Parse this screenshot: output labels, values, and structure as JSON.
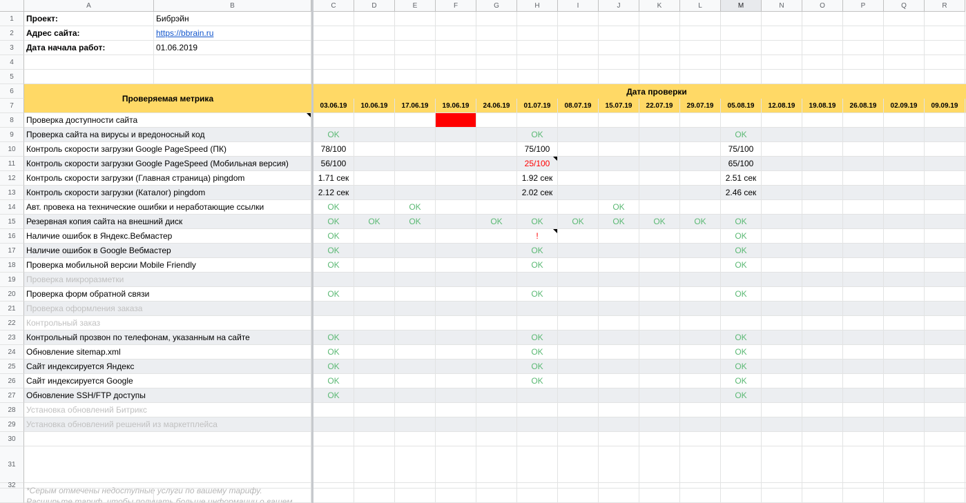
{
  "columns": [
    "A",
    "B",
    "",
    "C",
    "D",
    "E",
    "F",
    "G",
    "H",
    "I",
    "J",
    "K",
    "L",
    "M",
    "N",
    "O",
    "P",
    "Q",
    "R"
  ],
  "selected_column": "M",
  "row_numbers": [
    "1",
    "2",
    "3",
    "4",
    "5",
    "6",
    "7",
    "8",
    "9",
    "10",
    "11",
    "12",
    "13",
    "14",
    "15",
    "16",
    "17",
    "18",
    "19",
    "20",
    "21",
    "22",
    "23",
    "24",
    "25",
    "26",
    "27",
    "28",
    "29",
    "30",
    "31",
    "32"
  ],
  "project_info": [
    {
      "label": "Проект:",
      "value": "Бибрэйн",
      "link": false
    },
    {
      "label": "Адрес сайта:",
      "value": "https://bbrain.ru",
      "link": true
    },
    {
      "label": "Дата начала работ:",
      "value": "01.06.2019",
      "link": false
    }
  ],
  "metric_header": "Проверяемая метрика",
  "date_header": "Дата проверки",
  "dates": [
    "03.06.19",
    "10.06.19",
    "17.06.19",
    "19.06.19",
    "24.06.19",
    "01.07.19",
    "08.07.19",
    "15.07.19",
    "22.07.19",
    "29.07.19",
    "05.08.19",
    "12.08.19",
    "19.08.19",
    "26.08.19",
    "02.09.19",
    "09.09.19"
  ],
  "metrics": [
    {
      "name": "Проверка доступности сайта",
      "disabled": false,
      "values": [
        "",
        "",
        "",
        "",
        "",
        "",
        "",
        "",
        "",
        "",
        "",
        "",
        "",
        "",
        "",
        ""
      ],
      "red_cell": 3,
      "comment": true
    },
    {
      "name": "Проверка сайта на вирусы и вредоносный код",
      "disabled": false,
      "values": [
        "OK",
        "",
        "",
        "",
        "",
        "OK",
        "",
        "",
        "",
        "",
        "OK",
        "",
        "",
        "",
        "",
        ""
      ]
    },
    {
      "name": "Контроль скорости загрузки Google PageSpeed (ПК)",
      "disabled": false,
      "values": [
        "78/100",
        "",
        "",
        "",
        "",
        "75/100",
        "",
        "",
        "",
        "",
        "75/100",
        "",
        "",
        "",
        "",
        ""
      ]
    },
    {
      "name": "Контроль скорости загрузки Google PageSpeed (Мобильная версия)",
      "disabled": false,
      "values": [
        "56/100",
        "",
        "",
        "",
        "",
        "25/100",
        "",
        "",
        "",
        "",
        "65/100",
        "",
        "",
        "",
        "",
        ""
      ],
      "red_value": 5,
      "value_comment": 5
    },
    {
      "name": "Контроль скорости загрузки (Главная страница) pingdom",
      "disabled": false,
      "values": [
        "1.71 сек",
        "",
        "",
        "",
        "",
        "1.92 сек",
        "",
        "",
        "",
        "",
        "2.51 сек",
        "",
        "",
        "",
        "",
        ""
      ]
    },
    {
      "name": "Контроль скорости загрузки (Каталог) pingdom",
      "disabled": false,
      "values": [
        "2.12 сек",
        "",
        "",
        "",
        "",
        "2.02 сек",
        "",
        "",
        "",
        "",
        "2.46 сек",
        "",
        "",
        "",
        "",
        ""
      ]
    },
    {
      "name": "Авт. провека на технические ошибки и неработающие ссылки",
      "disabled": false,
      "values": [
        "OK",
        "",
        "OK",
        "",
        "",
        "",
        "",
        "OK",
        "",
        "",
        "",
        "",
        "",
        "",
        "",
        ""
      ]
    },
    {
      "name": "Резервная копия сайта на внешний диск",
      "disabled": false,
      "values": [
        "OK",
        "OK",
        "OK",
        "",
        "OK",
        "OK",
        "OK",
        "OK",
        "OK",
        "OK",
        "OK",
        "",
        "",
        "",
        "",
        ""
      ]
    },
    {
      "name": "Наличие ошибок в Яндекс.Вебмастер",
      "disabled": false,
      "values": [
        "OK",
        "",
        "",
        "",
        "",
        "!",
        "",
        "",
        "",
        "",
        "OK",
        "",
        "",
        "",
        "",
        ""
      ],
      "red_value": 5,
      "value_comment": 5
    },
    {
      "name": "Наличие ошибок в Google Вебмастер",
      "disabled": false,
      "values": [
        "OK",
        "",
        "",
        "",
        "",
        "OK",
        "",
        "",
        "",
        "",
        "OK",
        "",
        "",
        "",
        "",
        ""
      ]
    },
    {
      "name": "Проверка мобильной версии Mobile Friendly",
      "disabled": false,
      "values": [
        "OK",
        "",
        "",
        "",
        "",
        "OK",
        "",
        "",
        "",
        "",
        "OK",
        "",
        "",
        "",
        "",
        ""
      ]
    },
    {
      "name": "Проверка микроразметки",
      "disabled": true,
      "values": [
        "",
        "",
        "",
        "",
        "",
        "",
        "",
        "",
        "",
        "",
        "",
        "",
        "",
        "",
        "",
        ""
      ]
    },
    {
      "name": "Проверка форм обратной связи",
      "disabled": false,
      "values": [
        "OK",
        "",
        "",
        "",
        "",
        "OK",
        "",
        "",
        "",
        "",
        "OK",
        "",
        "",
        "",
        "",
        ""
      ]
    },
    {
      "name": "Проверка оформления заказа",
      "disabled": true,
      "values": [
        "",
        "",
        "",
        "",
        "",
        "",
        "",
        "",
        "",
        "",
        "",
        "",
        "",
        "",
        "",
        ""
      ]
    },
    {
      "name": "Контрольный заказ",
      "disabled": true,
      "values": [
        "",
        "",
        "",
        "",
        "",
        "",
        "",
        "",
        "",
        "",
        "",
        "",
        "",
        "",
        "",
        ""
      ]
    },
    {
      "name": "Контрольный прозвон по телефонам, указанным на сайте",
      "disabled": false,
      "values": [
        "OK",
        "",
        "",
        "",
        "",
        "OK",
        "",
        "",
        "",
        "",
        "OK",
        "",
        "",
        "",
        "",
        ""
      ]
    },
    {
      "name": "Обновление sitemap.xml",
      "disabled": false,
      "values": [
        "OK",
        "",
        "",
        "",
        "",
        "OK",
        "",
        "",
        "",
        "",
        "OK",
        "",
        "",
        "",
        "",
        ""
      ]
    },
    {
      "name": "Сайт индексируется Яндекс",
      "disabled": false,
      "values": [
        "OK",
        "",
        "",
        "",
        "",
        "OK",
        "",
        "",
        "",
        "",
        "OK",
        "",
        "",
        "",
        "",
        ""
      ]
    },
    {
      "name": "Сайт индексируется Google",
      "disabled": false,
      "values": [
        "OK",
        "",
        "",
        "",
        "",
        "OK",
        "",
        "",
        "",
        "",
        "OK",
        "",
        "",
        "",
        "",
        ""
      ]
    },
    {
      "name": "Обновление SSH/FTP доступы",
      "disabled": false,
      "values": [
        "OK",
        "",
        "",
        "",
        "",
        "",
        "",
        "",
        "",
        "",
        "OK",
        "",
        "",
        "",
        "",
        ""
      ]
    },
    {
      "name": "Установка обновлений Битрикс",
      "disabled": true,
      "values": [
        "",
        "",
        "",
        "",
        "",
        "",
        "",
        "",
        "",
        "",
        "",
        "",
        "",
        "",
        "",
        ""
      ]
    },
    {
      "name": "Установка обновлений решений из маркетплейса",
      "disabled": true,
      "values": [
        "",
        "",
        "",
        "",
        "",
        "",
        "",
        "",
        "",
        "",
        "",
        "",
        "",
        "",
        "",
        ""
      ]
    }
  ],
  "footnote": "*Серым отмечены недоступные услуги по вашему тарифу. Расширьте тариф, чтобы получать больше информации о вашем проекте",
  "colors": {
    "ok": "#5bb974",
    "alert": "#ff0000",
    "header_fill": "#ffd966",
    "disabled_text": "#c0c0c0",
    "link": "#1155cc"
  }
}
